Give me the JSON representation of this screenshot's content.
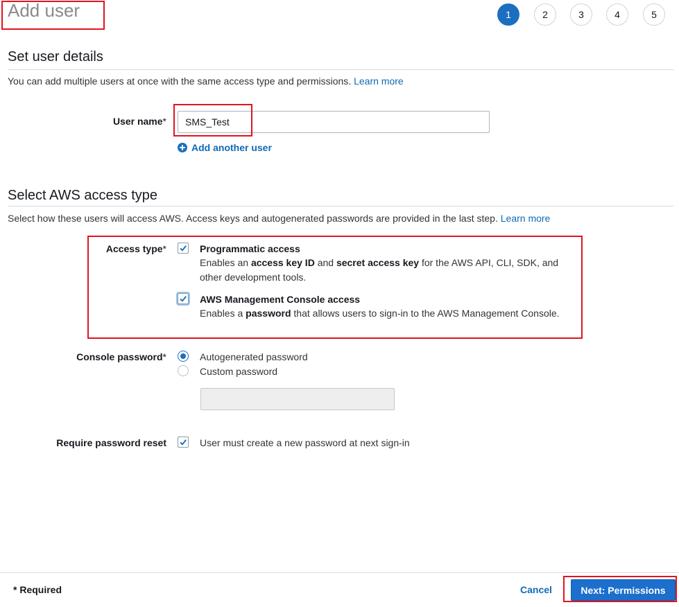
{
  "header": {
    "title": "Add user"
  },
  "steps": [
    "1",
    "2",
    "3",
    "4",
    "5"
  ],
  "details": {
    "title": "Set user details",
    "description": "You can add multiple users at once with the same access type and permissions.",
    "learn_more": "Learn more",
    "user_name_label": "User name",
    "required_mark": "*",
    "user_name_value": "SMS_Test",
    "add_another": "Add another user"
  },
  "access": {
    "title": "Select AWS access type",
    "description": "Select how these users will access AWS. Access keys and autogenerated passwords are provided in the last step.",
    "learn_more": "Learn more",
    "access_type_label": "Access type",
    "programmatic_title": "Programmatic access",
    "programmatic_text": {
      "p1": "Enables an ",
      "b1": "access key ID",
      "p2": " and ",
      "b2": "secret access key",
      "p3": " for the AWS API, CLI, SDK, and other development tools."
    },
    "programmatic_checked": true,
    "console_title": "AWS Management Console access",
    "console_text": {
      "p1": "Enables a ",
      "b1": "password",
      "p2": " that allows users to sign-in to the AWS Management Console."
    },
    "console_checked": true
  },
  "password": {
    "label": "Console password",
    "options": [
      "Autogenerated password",
      "Custom password"
    ],
    "selected": "Autogenerated password",
    "custom_value": "",
    "reset_label": "Require password reset",
    "reset_text": "User must create a new password at next sign-in",
    "reset_checked": true
  },
  "footer": {
    "required_note": "* Required",
    "cancel": "Cancel",
    "next": "Next: Permissions"
  },
  "colors": {
    "accent": "#1c6fbf",
    "highlight": "#e0141e",
    "link": "#0f6ab4"
  },
  "icons": {
    "add": "plus-circle-icon",
    "check": "checkmark-icon"
  }
}
